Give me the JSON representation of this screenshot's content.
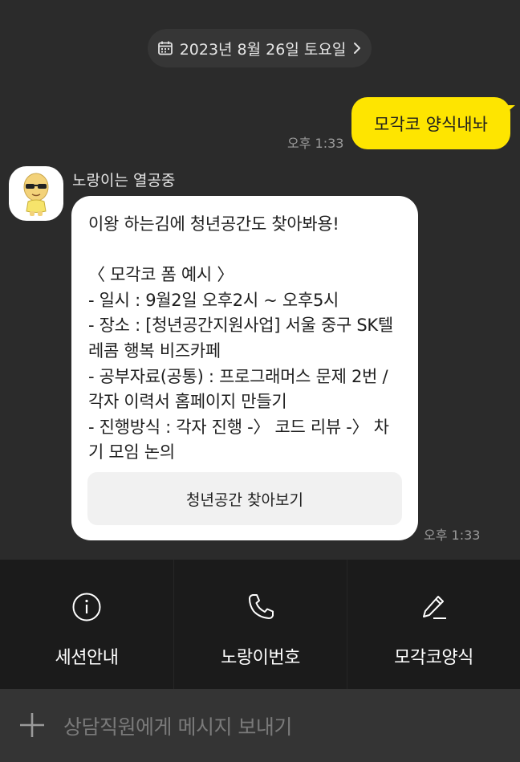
{
  "date_pill": {
    "text": "2023년 8월 26일 토요일",
    "icons": [
      "calendar-icon",
      "chevron-right-icon"
    ]
  },
  "messages": {
    "me": {
      "text": "모각코 양식내놔",
      "time": "오후 1:33"
    },
    "bot": {
      "sender": "노랑이는 열공중",
      "text": "이왕 하는김에 청년공간도 찾아봐용!\n\n〈 모각코 폼 예시 〉\n- 일시 : 9월2일 오후2시 ~ 오후5시\n- 장소 : [청년공간지원사업] 서울 중구 SK텔레콤 행복 비즈카페\n- 공부자료(공통) : 프로그래머스 문제 2번 / 각자 이력서 홈페이지 만들기\n- 진행방식 : 각자 진행 -〉 코드 리뷰 -〉 차기 모임 논의",
      "button": "청년공간 찾아보기",
      "time": "오후 1:33"
    }
  },
  "menu": {
    "items": [
      {
        "label": "세션안내",
        "icon": "info-icon"
      },
      {
        "label": "노랑이번호",
        "icon": "phone-icon"
      },
      {
        "label": "모각코양식",
        "icon": "pencil-icon"
      }
    ]
  },
  "input": {
    "placeholder": "상담직원에게 메시지 보내기",
    "icon": "plus-icon"
  },
  "colors": {
    "background": "#2b2b2b",
    "my_bubble": "#fee500",
    "bot_bubble": "#ffffff",
    "menu_bg": "#1b1b1b",
    "input_bg": "#343434"
  }
}
